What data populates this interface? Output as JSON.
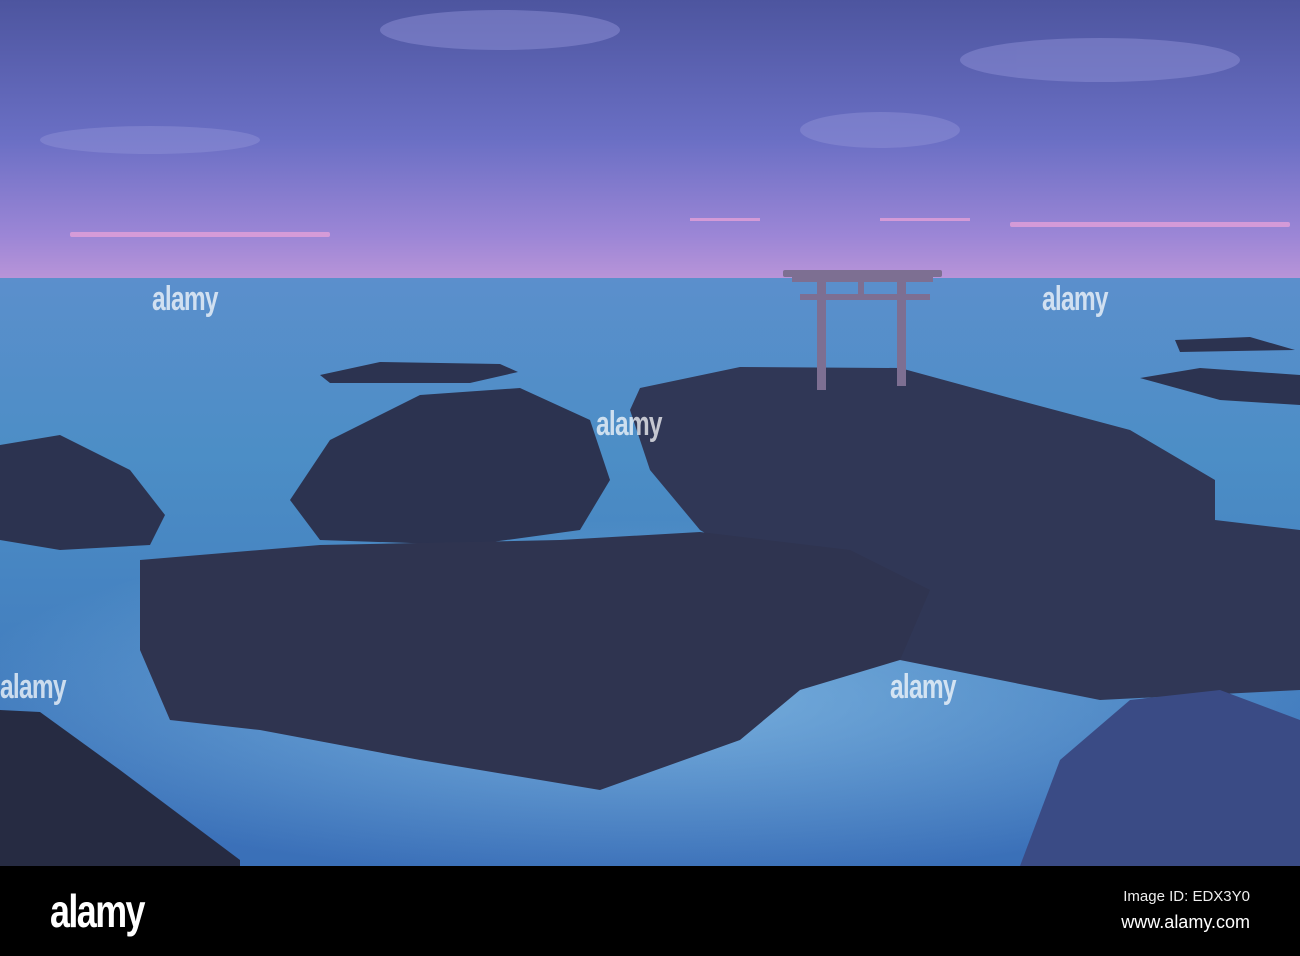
{
  "photo": {
    "subject": "torii-gate-on-rocks-at-sea",
    "colors": {
      "sky_top": "#5a62b8",
      "sky_horizon": "#b48fd8",
      "sea": "#4f8fc8",
      "rock": "#2a3048",
      "torii": "#7a6a8a"
    }
  },
  "watermark": {
    "text": "alamy"
  },
  "footer": {
    "logo": "alamy",
    "image_id": "Image ID: EDX3Y0",
    "url": "www.alamy.com"
  }
}
